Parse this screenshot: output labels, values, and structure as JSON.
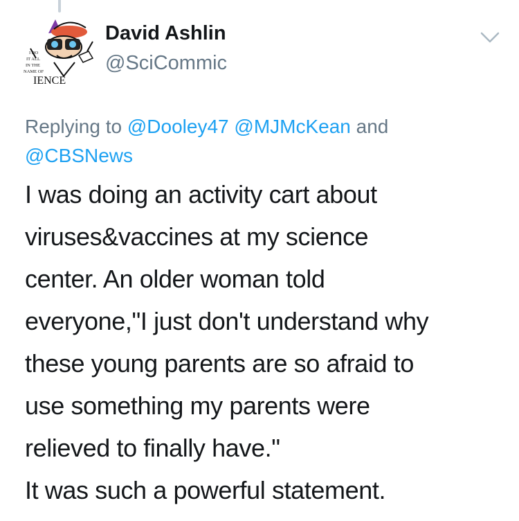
{
  "tweet": {
    "author_name": "David Ashlin",
    "author_handle": "@SciCommic",
    "replying_prefix": "Replying to",
    "mentions": [
      "@Dooley47",
      "@MJMcKean",
      "@CBSNews"
    ],
    "replying_conjunction": "and",
    "text": "I was doing an activity cart about\nviruses&vaccines at my science\ncenter. An older woman told\neveryone,\"I just don't understand why\nthese young parents are so afraid to\nuse something my parents were\nrelieved to finally have.\"\nIt was such a powerful statement."
  },
  "avatar": {
    "icon": "cartoon-scientist-avatar-icon",
    "lines": [
      "I DO",
      "IT ALL",
      "IN THE",
      "NAME OF",
      "IENCE"
    ]
  },
  "menu": {
    "icon": "chevron-down-icon"
  },
  "colors": {
    "text": "#14171a",
    "secondary": "#657786",
    "link": "#1da1f2",
    "thread_line": "#c8d1d9"
  }
}
